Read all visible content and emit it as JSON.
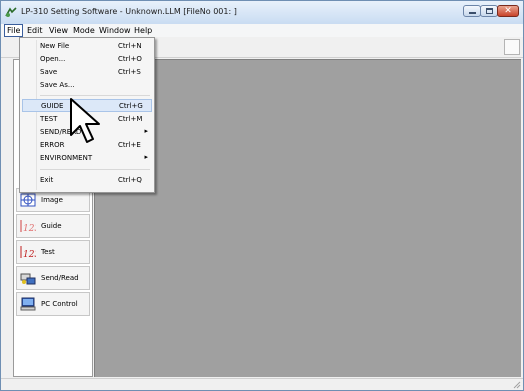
{
  "window": {
    "title": "LP-310 Setting Software - Unknown.LLM  [FileNo 001: ]"
  },
  "menubar": {
    "items": [
      "File",
      "Edit",
      "View",
      "Mode",
      "Window",
      "Help"
    ]
  },
  "file_menu": {
    "items": [
      {
        "label": "New File",
        "shortcut": "Ctrl+N"
      },
      {
        "label": "Open...",
        "shortcut": "Ctrl+O"
      },
      {
        "label": "Save",
        "shortcut": "Ctrl+S"
      },
      {
        "label": "Save As...",
        "shortcut": ""
      },
      {
        "label": "GUIDE",
        "shortcut": "Ctrl+G"
      },
      {
        "label": "TEST",
        "shortcut": "Ctrl+M"
      },
      {
        "label": "SEND/READ",
        "shortcut": "",
        "submenu": true
      },
      {
        "label": "ERROR",
        "shortcut": "Ctrl+E"
      },
      {
        "label": "ENVIRONMENT",
        "shortcut": "",
        "submenu": true
      },
      {
        "label": "Exit",
        "shortcut": "Ctrl+Q"
      }
    ],
    "highlighted": "GUIDE"
  },
  "left_panel": {
    "buttons": [
      {
        "label": "Image",
        "icon": "image-icon"
      },
      {
        "label": "Guide",
        "icon": "guide-icon"
      },
      {
        "label": "Test",
        "icon": "test-icon"
      },
      {
        "label": "Send/Read",
        "icon": "send-read-icon"
      },
      {
        "label": "PC Control",
        "icon": "pc-control-icon"
      }
    ]
  },
  "colors": {
    "main_area": "#a0a0a0",
    "menu_highlight": "#dce8f8",
    "close_button": "#c8432a"
  }
}
